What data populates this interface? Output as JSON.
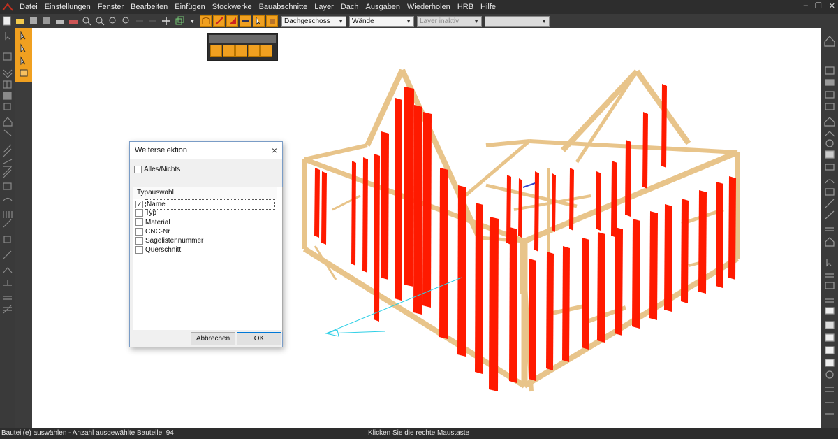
{
  "menu": [
    "Datei",
    "Einstellungen",
    "Fenster",
    "Bearbeiten",
    "Einfügen",
    "Stockwerke",
    "Bauabschnitte",
    "Layer",
    "Dach",
    "Ausgaben",
    "Wiederholen",
    "HRB",
    "Hilfe"
  ],
  "toolbar": {
    "floor_select": "Dachgeschoss",
    "element_select": "Wände",
    "layer_select": "Layer inaktiv",
    "empty_select": ""
  },
  "dialog": {
    "title": "Weiterselektion",
    "close_glyph": "×",
    "all_none_label": "Alles/Nichts",
    "list_header": "Typauswahl",
    "items": [
      {
        "label": "Name",
        "checked": true
      },
      {
        "label": "Typ",
        "checked": false
      },
      {
        "label": "Material",
        "checked": false
      },
      {
        "label": "CNC-Nr",
        "checked": false
      },
      {
        "label": "Sägelistennummer",
        "checked": false
      },
      {
        "label": "Querschnitt",
        "checked": false
      }
    ],
    "cancel_label": "Abbrechen",
    "ok_label": "OK"
  },
  "status": {
    "left": "Bauteil(e) auswählen  - Anzahl ausgewählte Bauteile: 94",
    "middle": "Klicken Sie die rechte Maustaste"
  },
  "colors": {
    "accent": "#f0a020",
    "wood": "#e8c48a",
    "selected": "#ff1a00",
    "bg_dark": "#3a3a3a"
  }
}
